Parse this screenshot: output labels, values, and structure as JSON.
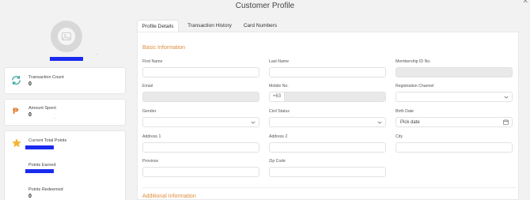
{
  "page": {
    "title": "Customer Profile"
  },
  "profile": {
    "name_redacted": true,
    "dot": "·"
  },
  "stats": {
    "transaction_count": {
      "label": "Transaction Count",
      "value": "0"
    },
    "amount_spent": {
      "label": "Amount Spent",
      "value": "0",
      "dot": "·"
    },
    "points": {
      "label": "Current Total Points",
      "earned_label": "Points Earned",
      "redeemed_label": "Points Redeemed",
      "redeemed_value": "0"
    }
  },
  "tabs": [
    {
      "label": "Profile Details",
      "active": true
    },
    {
      "label": "Transaction History",
      "active": false
    },
    {
      "label": "Card Numbers",
      "active": false
    }
  ],
  "sections": {
    "basic": "Basic Information",
    "additional": "Additional Information"
  },
  "form": {
    "first_name": {
      "label": "First Name",
      "value": ""
    },
    "last_name": {
      "label": "Last Name",
      "value": ""
    },
    "membership_id": {
      "label": "Membership ID No.",
      "value": ""
    },
    "email": {
      "label": "Email",
      "value": ""
    },
    "mobile": {
      "label": "Mobile No.",
      "prefix": "+63",
      "value": ""
    },
    "registration_channel": {
      "label": "Registration Channel",
      "value": ""
    },
    "gender": {
      "label": "Gender",
      "value": ""
    },
    "civil_status": {
      "label": "Civil Status",
      "value": ""
    },
    "birth_date": {
      "label": "Birth Date",
      "placeholder": "Pick date"
    },
    "address1": {
      "label": "Address 1",
      "value": ""
    },
    "address2": {
      "label": "Address 2",
      "value": ""
    },
    "city": {
      "label": "City",
      "value": ""
    },
    "province": {
      "label": "Province",
      "value": ""
    },
    "zip": {
      "label": "Zip Code",
      "value": ""
    }
  },
  "colors": {
    "accent": "#e08d3c",
    "redaction": "#1a2bef",
    "icon_teal": "#3aa7a0",
    "icon_orange": "#e07a2c",
    "star": "#f2b632"
  },
  "icons": [
    "refresh-icon",
    "peso-icon",
    "star-icon",
    "chevron-down-icon",
    "calendar-icon",
    "image-icon"
  ]
}
